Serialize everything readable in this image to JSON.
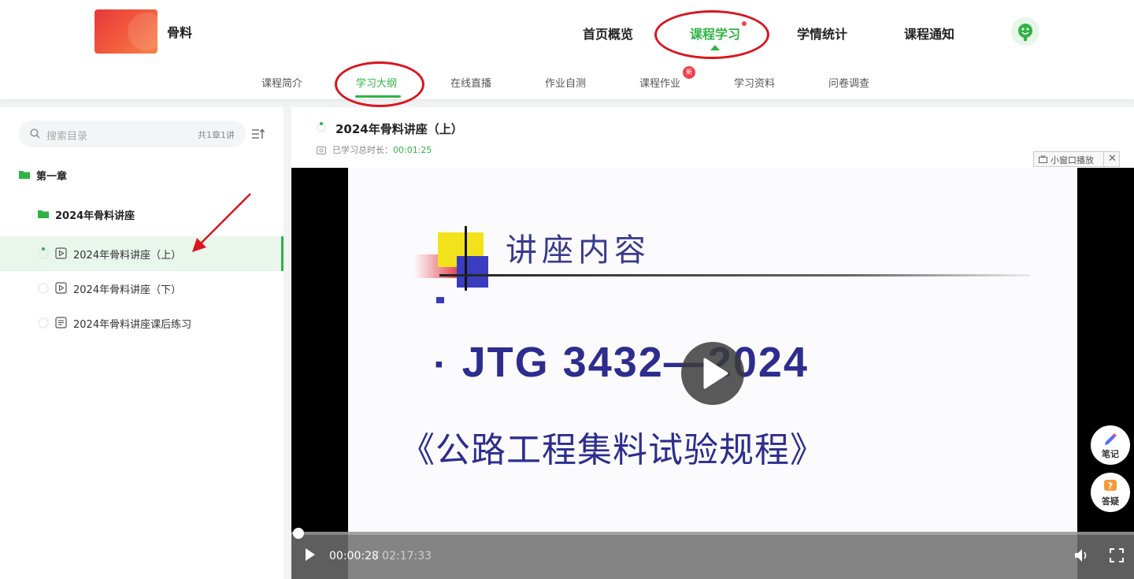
{
  "header": {
    "course_name": "骨料",
    "nav": [
      {
        "label": "首页概览"
      },
      {
        "label": "课程学习"
      },
      {
        "label": "学情统计"
      },
      {
        "label": "课程通知"
      }
    ],
    "subnav": [
      {
        "label": "课程简介"
      },
      {
        "label": "学习大纲"
      },
      {
        "label": "在线直播"
      },
      {
        "label": "作业自测"
      },
      {
        "label": "课程作业"
      },
      {
        "label": "学习资料"
      },
      {
        "label": "问卷调查"
      }
    ],
    "new_badge": "新",
    "accent_color": "#2fb344",
    "annotation_color": "#d9161f"
  },
  "sidebar": {
    "search_placeholder": "搜索目录",
    "count_text": "共1章1讲",
    "chapter": "第一章",
    "section": "2024年骨料讲座",
    "lessons": [
      {
        "label": "2024年骨料讲座（上）",
        "type": "video-icon",
        "active": true
      },
      {
        "label": "2024年骨料讲座（下）",
        "type": "video-icon",
        "active": false
      },
      {
        "label": "2024年骨料讲座课后练习",
        "type": "document-icon",
        "active": false
      }
    ]
  },
  "main": {
    "lesson_title": "2024年骨料讲座（上）",
    "study_time_label": "已学习总时长：",
    "study_time_value": "00:01:25",
    "mini_player_label": "小窗口播放",
    "close_symbol": "✕"
  },
  "video": {
    "slide_heading": "讲座内容",
    "slide_bullet": "▪",
    "slide_code": "JTG 3432—2024",
    "slide_sub": "《公路工程集料试验规程》",
    "current_time": "00:00:28",
    "total_time": "/ 02:17:33",
    "progress_fraction": 0.0034
  },
  "floating": {
    "notes_label": "笔记",
    "qa_label": "答疑"
  }
}
